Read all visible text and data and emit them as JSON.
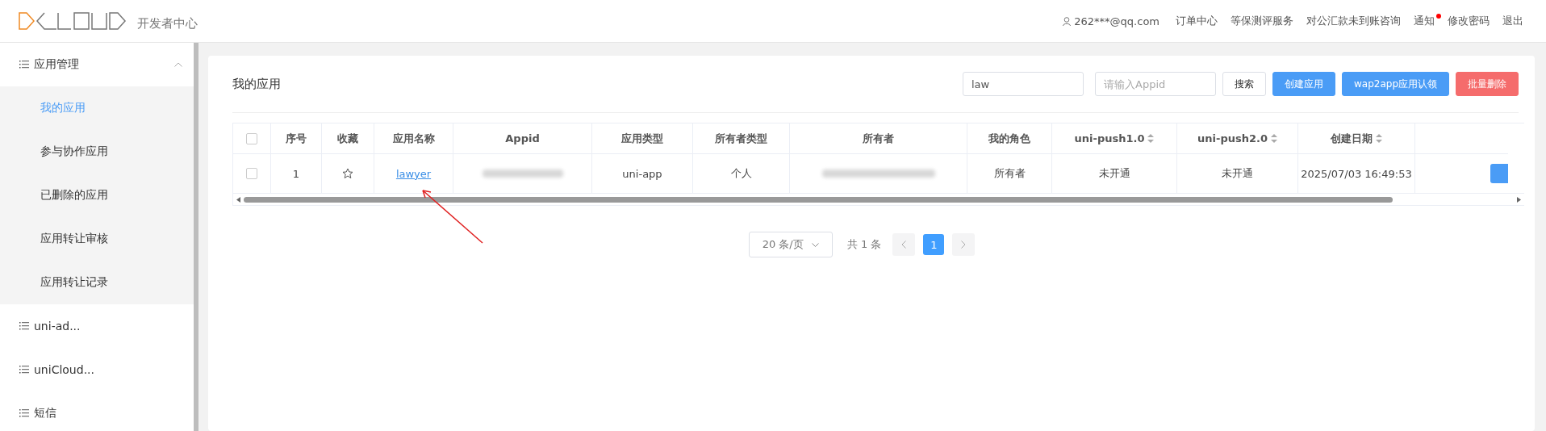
{
  "header": {
    "subtitle": "开发者中心",
    "user": "262***@qq.com",
    "links": [
      {
        "label": "订单中心",
        "badge": false
      },
      {
        "label": "等保测评服务",
        "badge": false
      },
      {
        "label": "对公汇款未到账咨询",
        "badge": false
      },
      {
        "label": "通知",
        "badge": true
      },
      {
        "label": "修改密码",
        "badge": false
      },
      {
        "label": "退出",
        "badge": false
      }
    ]
  },
  "sidebar": {
    "groups": [
      {
        "label": "应用管理",
        "expanded": true,
        "children": [
          {
            "label": "我的应用",
            "selected": true
          },
          {
            "label": "参与协作应用",
            "selected": false
          },
          {
            "label": "已删除的应用",
            "selected": false
          },
          {
            "label": "应用转让审核",
            "selected": false
          },
          {
            "label": "应用转让记录",
            "selected": false
          }
        ]
      },
      {
        "label": "uni-ad...",
        "expanded": false
      },
      {
        "label": "uniCloud...",
        "expanded": false
      },
      {
        "label": "短信",
        "expanded": false
      }
    ]
  },
  "page": {
    "title": "我的应用",
    "search_value": "law",
    "appid_placeholder": "请输入Appid",
    "buttons": [
      {
        "label": "搜索",
        "kind": "plain"
      },
      {
        "label": "创建应用",
        "kind": "primary"
      },
      {
        "label": "wap2app应用认领",
        "kind": "primary"
      },
      {
        "label": "批量删除",
        "kind": "danger"
      }
    ]
  },
  "table": {
    "select_all_checked": false,
    "columns": [
      {
        "label": "序号",
        "sortable": false
      },
      {
        "label": "收藏",
        "sortable": false
      },
      {
        "label": "应用名称",
        "sortable": false
      },
      {
        "label": "Appid",
        "sortable": false
      },
      {
        "label": "应用类型",
        "sortable": false
      },
      {
        "label": "所有者类型",
        "sortable": false
      },
      {
        "label": "所有者",
        "sortable": false
      },
      {
        "label": "我的角色",
        "sortable": false
      },
      {
        "label": "uni-push1.0",
        "sortable": true
      },
      {
        "label": "uni-push2.0",
        "sortable": true
      },
      {
        "label": "创建日期",
        "sortable": true
      }
    ],
    "rows": [
      {
        "checked": false,
        "index": "1",
        "favorite": false,
        "name": "lawyer",
        "app_type": "uni-app",
        "owner_type": "个人",
        "role": "所有者",
        "push1": "未开通",
        "push2": "未开通",
        "created": "2025/07/03 16:49:53"
      }
    ]
  },
  "pagination": {
    "page_size": "20 条/页",
    "total": "共 1 条",
    "pages": [
      {
        "label": "1",
        "selected": true
      }
    ]
  }
}
